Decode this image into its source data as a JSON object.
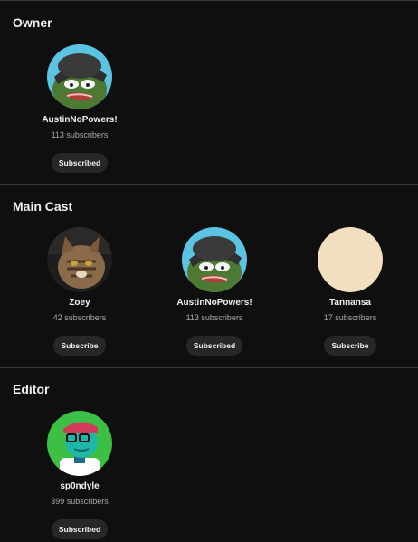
{
  "sections": [
    {
      "title": "Owner",
      "creators": [
        {
          "name": "AustinNoPowers!",
          "subscribers": "113 subscribers",
          "button": "Subscribed",
          "avatar_icon": "pepe-beanie-avatar"
        }
      ]
    },
    {
      "title": "Main Cast",
      "creators": [
        {
          "name": "Zoey",
          "subscribers": "42 subscribers",
          "button": "Subscribe",
          "avatar_icon": "cat-photo-avatar"
        },
        {
          "name": "AustinNoPowers!",
          "subscribers": "113 subscribers",
          "button": "Subscribed",
          "avatar_icon": "pepe-beanie-avatar"
        },
        {
          "name": "Tannansa",
          "subscribers": "17 subscribers",
          "button": "Subscribe",
          "avatar_icon": "blank-beige-avatar",
          "avatar_color": "#f1dfc0"
        }
      ]
    },
    {
      "title": "Editor",
      "creators": [
        {
          "name": "sp0ndyle",
          "subscribers": "399 subscribers",
          "button": "Subscribed",
          "avatar_icon": "cartoon-lizard-avatar"
        }
      ]
    }
  ],
  "colors": {
    "background": "#0f0f0f",
    "button_bg": "#272727",
    "divider": "#3a3a3a",
    "muted_text": "#aaaaaa"
  }
}
